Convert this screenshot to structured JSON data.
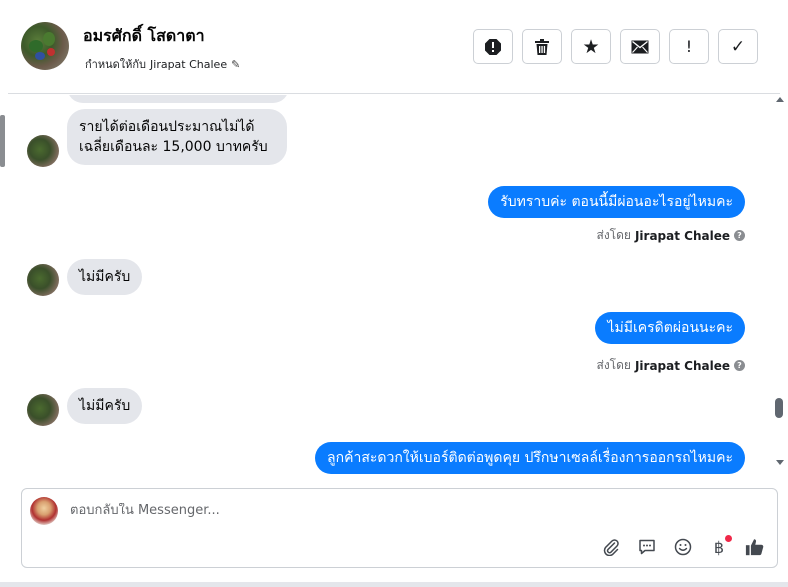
{
  "header": {
    "contact_name": "อมรศักดิ์ โสดาตา",
    "assign_prefix": "กำหนดให้กับ",
    "assigned_to": "Jirapat Chalee",
    "actions": [
      {
        "name": "report-button",
        "icon": "exclamation-octagon-icon",
        "glyph": "⬢"
      },
      {
        "name": "trash-button",
        "icon": "trash-icon",
        "glyph": "🗑"
      },
      {
        "name": "star-button",
        "icon": "star-icon",
        "glyph": "★"
      },
      {
        "name": "mail-button",
        "icon": "mail-icon",
        "glyph": "✉"
      },
      {
        "name": "follow-up-button",
        "icon": "exclamation-icon",
        "glyph": "!"
      },
      {
        "name": "done-button",
        "icon": "check-icon",
        "glyph": "✓"
      }
    ]
  },
  "messages": {
    "income_line1": "รายได้ต่อเดือนประมาณไม่ได้",
    "income_line2": "เฉลี่ยเดือนละ 15,000 บาทครับ",
    "out1": "รับทราบค่ะ ตอนนี้มีผ่อนอะไรอยู่ไหมคะ",
    "in2": "ไม่มีครับ",
    "out2": "ไม่มีเครดิตผ่อนนะคะ",
    "in3": "ไม่มีครับ",
    "out3": "ลูกค้าสะดวกให้เบอร์ติดต่อพูดคุย ปรึกษาเซลล์เรื่องการออกรถไหมคะ",
    "sent_by_prefix": "ส่งโดย",
    "sent_by_name": "Jirapat Chalee",
    "help_glyph": "?"
  },
  "composer": {
    "placeholder": "ตอบกลับใน Messenger..."
  },
  "colors": {
    "outgoing_bubble": "#0a7cff",
    "incoming_bubble": "#e4e6eb",
    "notification_dot": "#f02849"
  }
}
